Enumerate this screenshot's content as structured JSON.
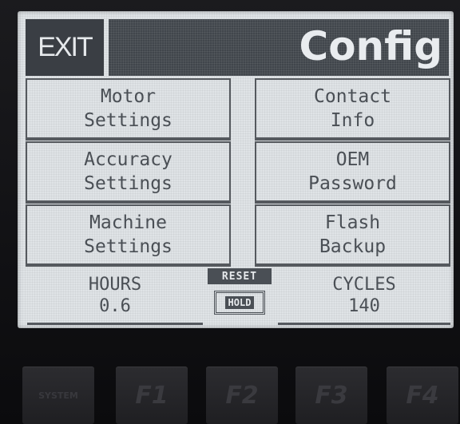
{
  "header": {
    "exit_label": "EXIT",
    "title": "Config"
  },
  "menu": {
    "motor_settings": [
      "Motor",
      "Settings"
    ],
    "accuracy_settings": [
      "Accuracy",
      "Settings"
    ],
    "machine_settings": [
      "Machine",
      "Settings"
    ],
    "contact_info": [
      "Contact",
      "Info"
    ],
    "oem_password": [
      "OEM",
      "Password"
    ],
    "flash_backup": [
      "Flash",
      "Backup"
    ]
  },
  "stats": {
    "hours_label": "HOURS",
    "hours_value": "0.6",
    "cycles_label": "CYCLES",
    "cycles_value": "140"
  },
  "reset": {
    "label": "RESET",
    "hold_label": "HOLD"
  },
  "function_keys": [
    "SYSTEM",
    "F1",
    "F2",
    "F3",
    "F4"
  ],
  "colors": {
    "lcd_bg": "#dfe3e6",
    "lcd_dark": "#41464c",
    "lcd_text": "#4a4f55",
    "bezel": "#111114"
  }
}
